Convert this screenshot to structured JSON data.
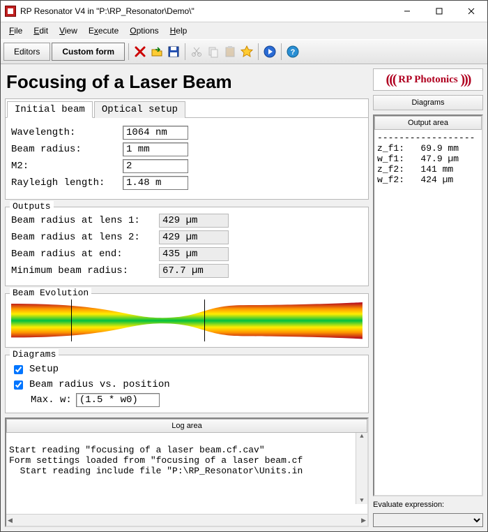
{
  "window": {
    "title": "RP Resonator V4 in \"P:\\RP_Resonator\\Demo\\\""
  },
  "menu": {
    "file": "File",
    "edit": "Edit",
    "view": "View",
    "execute": "Execute",
    "options": "Options",
    "help": "Help"
  },
  "toolbar": {
    "editors": "Editors",
    "custom": "Custom form"
  },
  "page": {
    "title": "Focusing of a Laser Beam"
  },
  "tabs": {
    "initial": "Initial beam",
    "optical": "Optical setup"
  },
  "form": {
    "wavelength_label": "Wavelength:",
    "wavelength": "1064 nm",
    "radius_label": "Beam radius:",
    "radius": "1 mm",
    "m2_label": "M2:",
    "m2": "2",
    "rayleigh_label": "Rayleigh length:",
    "rayleigh": "1.48 m"
  },
  "outputs": {
    "legend": "Outputs",
    "r1_label": "Beam radius at lens 1:",
    "r1": "429 µm",
    "r2_label": "Beam radius at lens 2:",
    "r2": "429 µm",
    "re_label": "Beam radius at end:",
    "re": "435 µm",
    "rmin_label": "Minimum beam radius:",
    "rmin": "67.7 µm"
  },
  "beam": {
    "legend": "Beam Evolution"
  },
  "diagrams": {
    "legend": "Diagrams",
    "setup": "Setup",
    "bvp": "Beam radius vs. position",
    "maxw_label": "Max. w:",
    "maxw": "(1.5 * w0)"
  },
  "log": {
    "header": "Log area",
    "l1": "Start reading \"focusing of a laser beam.cf.cav\"",
    "l2": "Form settings loaded from \"focusing of a laser beam.cf",
    "l3": "  Start reading include file \"P:\\RP_Resonator\\Units.in"
  },
  "side": {
    "logo": "RP Photonics",
    "diagrams_btn": "Diagrams",
    "output_hdr": "Output area",
    "sep": "------------------",
    "o1": "z_f1:   69.9 mm",
    "o2": "w_f1:   47.9 µm",
    "o3": "z_f2:   141 mm",
    "o4": "w_f2:   424 µm",
    "eval_label": "Evaluate expression:"
  }
}
